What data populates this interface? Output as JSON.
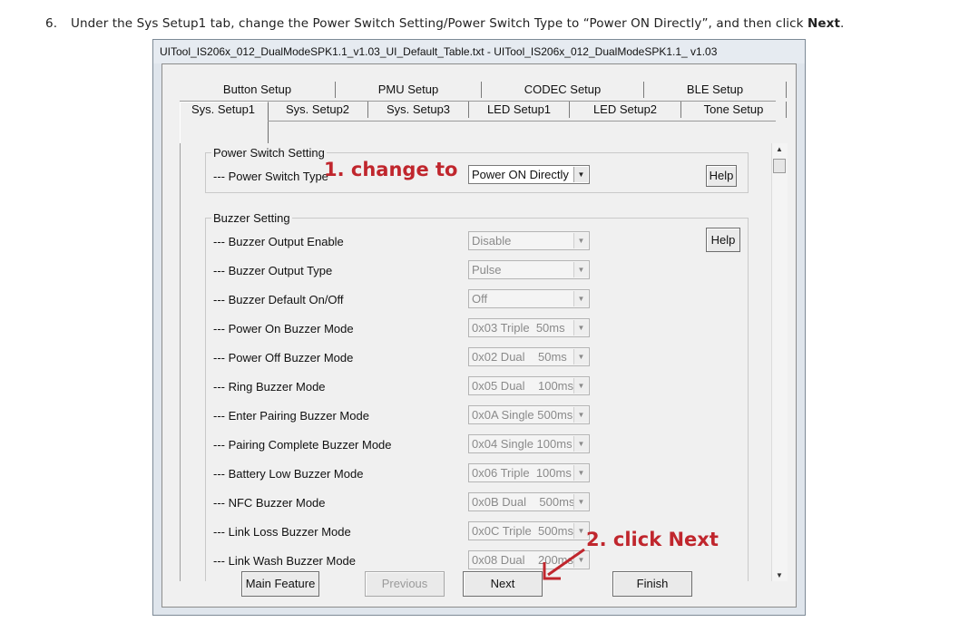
{
  "instruction": {
    "number": "6.",
    "text_before": "Under the Sys Setup1 tab, change the Power Switch Setting/Power Switch Type to “Power ON Directly”, and then click ",
    "bold": "Next",
    "text_after": "."
  },
  "window": {
    "title": "UITool_IS206x_012_DualModeSPK1.1_v1.03_UI_Default_Table.txt - UITool_IS206x_012_DualModeSPK1.1_ v1.03"
  },
  "tabs_back": [
    "Button Setup",
    "PMU Setup",
    "CODEC Setup",
    "BLE Setup"
  ],
  "tabs_front": [
    "Sys. Setup1",
    "Sys. Setup2",
    "Sys. Setup3",
    "LED Setup1",
    "LED Setup2",
    "Tone Setup"
  ],
  "power_switch": {
    "group_title": "Power Switch Setting",
    "label": "--- Power Switch Type",
    "value": "Power ON Directly",
    "help": "Help"
  },
  "buzzer": {
    "group_title": "Buzzer Setting",
    "help": "Help",
    "rows": [
      {
        "label": "--- Buzzer Output Enable",
        "value": "Disable"
      },
      {
        "label": "--- Buzzer Output Type",
        "value": "Pulse"
      },
      {
        "label": "--- Buzzer Default On/Off",
        "value": "Off"
      },
      {
        "label": "--- Power On Buzzer Mode",
        "value": "0x03 Triple  50ms"
      },
      {
        "label": "--- Power Off Buzzer Mode",
        "value": "0x02 Dual    50ms"
      },
      {
        "label": "--- Ring Buzzer Mode",
        "value": "0x05 Dual    100ms"
      },
      {
        "label": "--- Enter Pairing Buzzer Mode",
        "value": "0x0A Single 500ms"
      },
      {
        "label": "--- Pairing Complete Buzzer Mode",
        "value": "0x04 Single 100ms"
      },
      {
        "label": "--- Battery Low Buzzer Mode",
        "value": "0x06 Triple  100ms"
      },
      {
        "label": "--- NFC Buzzer Mode",
        "value": "0x0B Dual    500ms"
      },
      {
        "label": "--- Link Loss Buzzer Mode",
        "value": "0x0C Triple  500ms"
      },
      {
        "label": "--- Link Wash Buzzer Mode",
        "value": "0x08 Dual    200ms"
      }
    ]
  },
  "buttons": {
    "main_feature": "Main Feature",
    "previous": "Previous",
    "next": "Next",
    "finish": "Finish"
  },
  "annotations": {
    "step1": "1. change to",
    "step2": "2. click Next",
    "color": "#c0262d"
  },
  "icons": {
    "dropdown": "chevron-down-icon",
    "scroll_up": "scroll-up-arrow-icon",
    "scroll_down": "scroll-down-arrow-icon"
  }
}
